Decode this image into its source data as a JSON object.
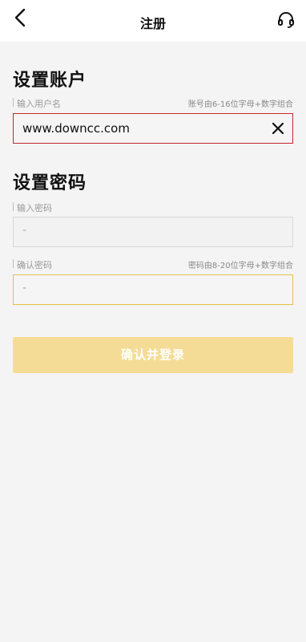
{
  "header": {
    "title": "注册",
    "back_icon": "chevron-left-icon",
    "support_icon": "headset-icon"
  },
  "account": {
    "section_title": "设置账户",
    "username_label": "输入用户名",
    "username_hint": "账号由6-16位字母+数字组合",
    "username_value": "www.downcc.com",
    "clear_icon": "close-icon"
  },
  "password": {
    "section_title": "设置密码",
    "password_label": "输入密码",
    "password_placeholder": "-",
    "confirm_label": "确认密码",
    "confirm_hint": "密码由8-20位字母+数字组合",
    "confirm_placeholder": "-"
  },
  "submit": {
    "label": "确认并登录"
  },
  "colors": {
    "accent_yellow": "#f5dc96",
    "focus_yellow": "#e6c04a",
    "error_red": "#c6262e",
    "background": "#f4f4f4"
  }
}
